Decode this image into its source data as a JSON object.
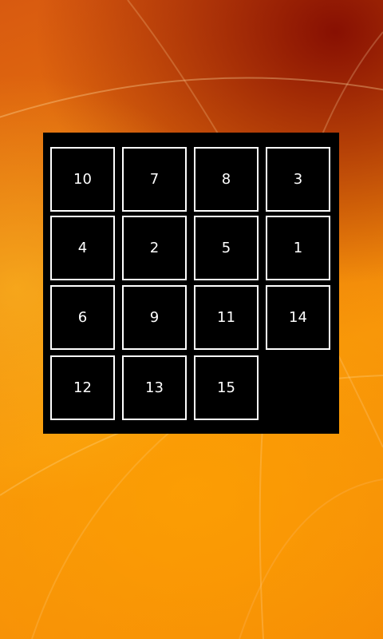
{
  "puzzle": {
    "tiles": [
      [
        "10",
        "7",
        "8",
        "3"
      ],
      [
        "4",
        "2",
        "5",
        "1"
      ],
      [
        "6",
        "9",
        "11",
        "14"
      ],
      [
        "12",
        "13",
        "15",
        ""
      ]
    ]
  },
  "colors": {
    "board": "#000000",
    "tile_border": "#ffffff",
    "tile_text": "#ffffff"
  }
}
